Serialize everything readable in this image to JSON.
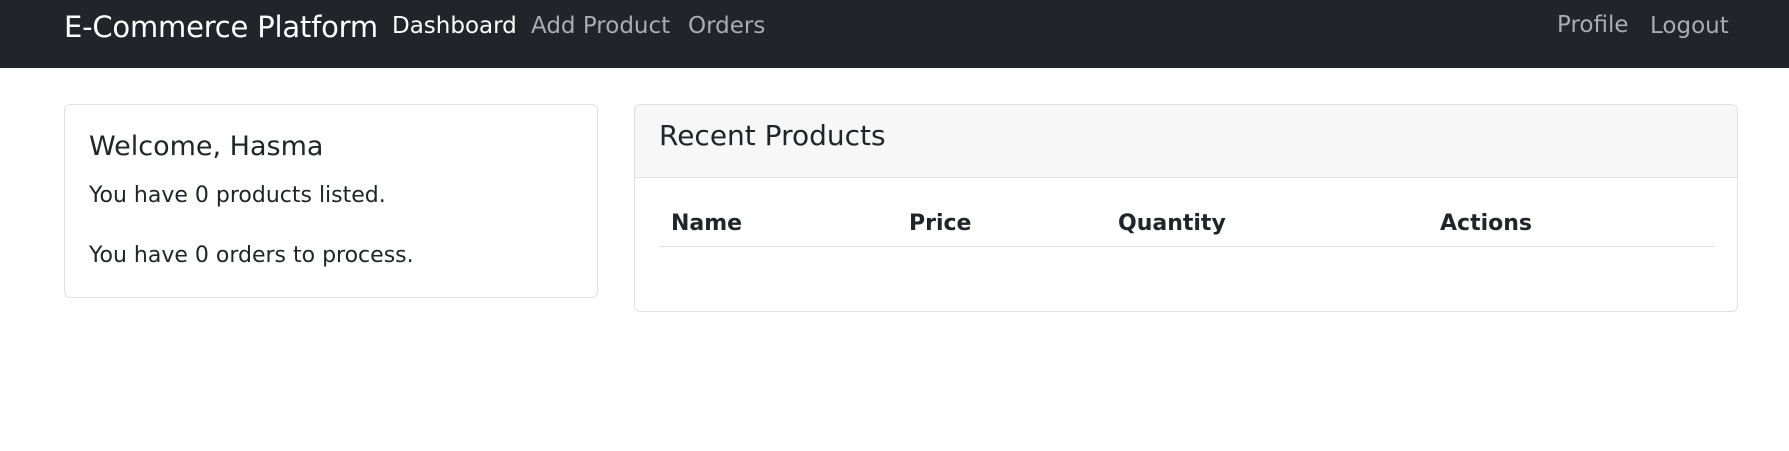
{
  "navbar": {
    "brand": "E-Commerce Platform",
    "left_links": [
      {
        "label": "Dashboard",
        "active": true
      },
      {
        "label": "Add Product",
        "active": false
      },
      {
        "label": "Orders",
        "active": false
      }
    ],
    "right_links": [
      {
        "label": "Profile"
      },
      {
        "label": "Logout"
      }
    ],
    "colors": {
      "background": "#212529",
      "active_link": "#ffffff",
      "inactive_link": "#a9acb0"
    }
  },
  "welcome": {
    "title": "Welcome, Hasma",
    "products_line": "You have 0 products listed.",
    "orders_line": "You have 0 orders to process."
  },
  "recent_products": {
    "title": "Recent Products",
    "columns": [
      "Name",
      "Price",
      "Quantity",
      "Actions"
    ],
    "rows": []
  }
}
